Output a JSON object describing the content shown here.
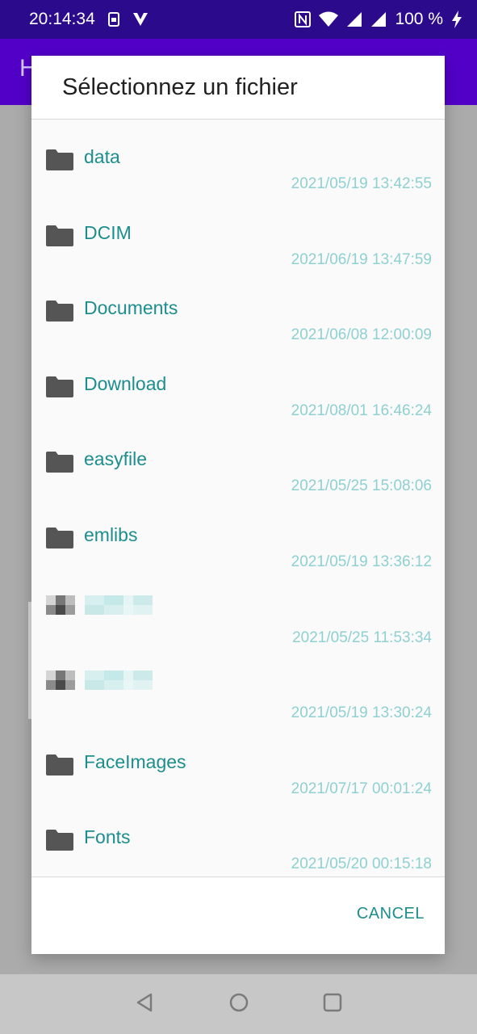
{
  "status_bar": {
    "time": "20:14:34",
    "battery": "100 %",
    "icons": [
      "sim-icon",
      "vpn-icon",
      "nfc-icon",
      "wifi-icon",
      "signal-icon",
      "signal-icon",
      "charging-icon"
    ]
  },
  "app_bar": {
    "title_fragment": "H"
  },
  "dialog": {
    "title": "Sélectionnez un fichier",
    "cancel_label": "CANCEL",
    "files": [
      {
        "name": "data",
        "date": "2021/05/19 13:42:55",
        "redacted": false
      },
      {
        "name": "DCIM",
        "date": "2021/06/19 13:47:59",
        "redacted": false
      },
      {
        "name": "Documents",
        "date": "2021/06/08 12:00:09",
        "redacted": false
      },
      {
        "name": "Download",
        "date": "2021/08/01 16:46:24",
        "redacted": false
      },
      {
        "name": "easyfile",
        "date": "2021/05/25 15:08:06",
        "redacted": false
      },
      {
        "name": "emlibs",
        "date": "2021/05/19 13:36:12",
        "redacted": false
      },
      {
        "name": "",
        "date": "2021/05/25 11:53:34",
        "redacted": true
      },
      {
        "name": "",
        "date": "2021/05/19 13:30:24",
        "redacted": true
      },
      {
        "name": "FaceImages",
        "date": "2021/07/17 00:01:24",
        "redacted": false
      },
      {
        "name": "Fonts",
        "date": "2021/05/20 00:15:18",
        "redacted": false
      }
    ]
  },
  "colors": {
    "status_bar": "#2c0a8c",
    "app_bar": "#5200c8",
    "accent_teal": "#1d8d8d",
    "date_teal": "#8fd0d0",
    "folder_icon": "#555555"
  }
}
